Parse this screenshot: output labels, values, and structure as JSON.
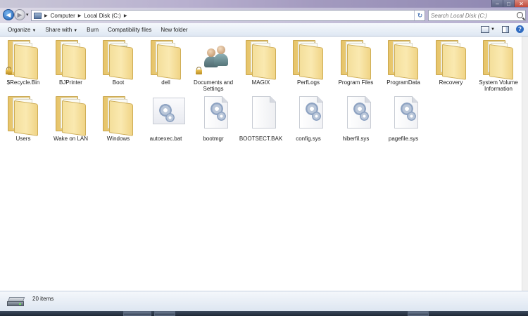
{
  "titlebar": {
    "controls": [
      "minimize",
      "maximize",
      "close"
    ]
  },
  "navigation": {
    "breadcrumb": [
      "Computer",
      "Local Disk (C:)"
    ],
    "search_placeholder": "Search Local Disk (C:)"
  },
  "toolbar": {
    "organize": "Organize",
    "share_with": "Share with",
    "burn": "Burn",
    "compatibility_files": "Compatibility files",
    "new_folder": "New folder"
  },
  "items": [
    {
      "name": "$Recycle.Bin",
      "type": "folder",
      "locked": true
    },
    {
      "name": "BJPrinter",
      "type": "folder",
      "locked": false
    },
    {
      "name": "Boot",
      "type": "folder-boot",
      "locked": false
    },
    {
      "name": "dell",
      "type": "folder",
      "locked": false
    },
    {
      "name": "Documents and Settings",
      "type": "folder-users",
      "locked": true
    },
    {
      "name": "MAGIX",
      "type": "folder",
      "locked": false
    },
    {
      "name": "PerfLogs",
      "type": "folder",
      "locked": false
    },
    {
      "name": "Program Files",
      "type": "folder",
      "locked": false
    },
    {
      "name": "ProgramData",
      "type": "folder",
      "locked": false
    },
    {
      "name": "Recovery",
      "type": "folder",
      "locked": false
    },
    {
      "name": "System Volume Information",
      "type": "folder",
      "locked": false
    },
    {
      "name": "Users",
      "type": "folder",
      "locked": false
    },
    {
      "name": "Wake on LAN",
      "type": "folder",
      "locked": false
    },
    {
      "name": "Windows",
      "type": "folder",
      "locked": false
    },
    {
      "name": "autoexec.bat",
      "type": "file-gear-wide",
      "locked": false
    },
    {
      "name": "bootmgr",
      "type": "file-gear",
      "locked": false
    },
    {
      "name": "BOOTSECT.BAK",
      "type": "file-blank",
      "locked": false
    },
    {
      "name": "config.sys",
      "type": "file-gear",
      "locked": false
    },
    {
      "name": "hiberfil.sys",
      "type": "file-gear",
      "locked": false
    },
    {
      "name": "pagefile.sys",
      "type": "file-gear",
      "locked": false
    }
  ],
  "status": {
    "count": "20 items"
  }
}
